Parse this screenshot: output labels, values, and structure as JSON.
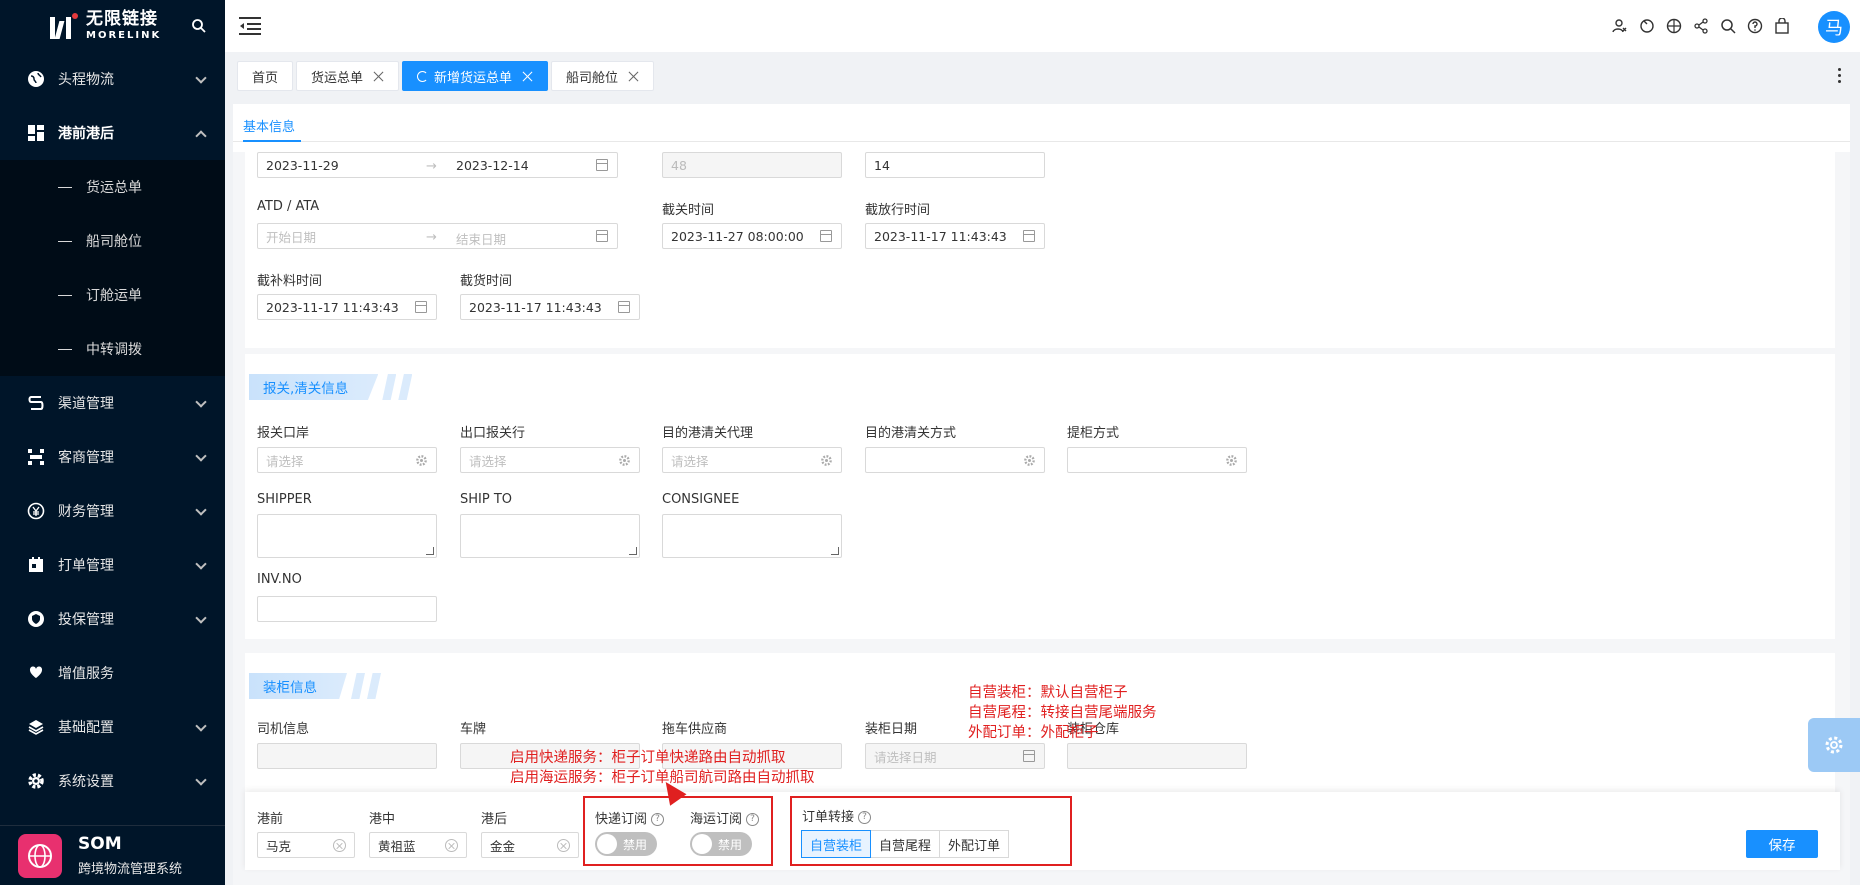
{
  "logo": {
    "cn": "无限链接",
    "en": "MORELINK"
  },
  "sidebar": {
    "items": [
      {
        "label": "头程物流",
        "icon": "globe-icon"
      },
      {
        "label": "港前港后",
        "icon": "dashboard-icon"
      },
      {
        "label": "渠道管理",
        "icon": "route-icon"
      },
      {
        "label": "客商管理",
        "icon": "network-icon"
      },
      {
        "label": "财务管理",
        "icon": "yen-icon"
      },
      {
        "label": "打单管理",
        "icon": "calendar-icon"
      },
      {
        "label": "投保管理",
        "icon": "shield-icon"
      },
      {
        "label": "增值服务",
        "icon": "heart-hand-icon"
      },
      {
        "label": "基础配置",
        "icon": "layers-icon"
      },
      {
        "label": "系统设置",
        "icon": "gear-icon"
      }
    ],
    "subitems": [
      "货运总单",
      "船司舱位",
      "订舱运单",
      "中转调拨"
    ]
  },
  "som": {
    "title": "SOM",
    "subtitle": "跨境物流管理系统"
  },
  "header": {
    "avatar": "马"
  },
  "tabs": [
    {
      "label": "首页",
      "closable": false
    },
    {
      "label": "货运总单",
      "closable": true
    },
    {
      "label": "新增货运总单",
      "closable": true,
      "active": true
    },
    {
      "label": "船司舱位",
      "closable": true
    }
  ],
  "content_tab": "基本信息",
  "basic": {
    "range1_start": "2023-11-29",
    "range1_end": "2023-12-14",
    "days": "48",
    "num": "14",
    "atd_label": "ATD / ATA",
    "atd_start_ph": "开始日期",
    "atd_end_ph": "结束日期",
    "cutoff_customs_label": "截关时间",
    "cutoff_customs": "2023-11-27 08:00:00",
    "cutoff_release_label": "截放行时间",
    "cutoff_release": "2023-11-17 11:43:43",
    "cutoff_supp_label": "截补料时间",
    "cutoff_supp": "2023-11-17 11:43:43",
    "cutoff_cargo_label": "截货时间",
    "cutoff_cargo": "2023-11-17 11:43:43"
  },
  "customs": {
    "title": "报关,清关信息",
    "port_label": "报关口岸",
    "export_label": "出口报关行",
    "dest_agent_label": "目的港清关代理",
    "dest_method_label": "目的港清关方式",
    "pickup_label": "提柜方式",
    "select_ph": "请选择",
    "shipper_label": "SHIPPER",
    "shipto_label": "SHIP TO",
    "consignee_label": "CONSIGNEE",
    "inv_label": "INV.NO"
  },
  "loading": {
    "title": "装柜信息",
    "driver_label": "司机信息",
    "plate_label": "车牌",
    "truck_label": "拖车供应商",
    "date_label": "装柜日期",
    "date_ph": "请选择日期",
    "warehouse_label": "装柜仓库"
  },
  "footer": {
    "pre_label": "港前",
    "pre_value": "马克",
    "mid_label": "港中",
    "mid_value": "黄祖蓝",
    "post_label": "港后",
    "post_value": "金金",
    "express_label": "快递订阅",
    "sea_label": "海运订阅",
    "toggle_text": "禁用",
    "convert_label": "订单转接",
    "seg": [
      "自营装柜",
      "自营尾程",
      "外配订单"
    ],
    "save": "保存"
  },
  "annotations": {
    "left": [
      "启用快递服务：柜子订单快递路由自动抓取",
      "启用海运服务：柜子订单船司航司路由自动抓取"
    ],
    "right": [
      "自营装柜：默认自营柜子",
      "自营尾程：转接自营尾端服务",
      "外配订单：外配柜子"
    ]
  },
  "colors": {
    "accent": "#1890ff",
    "sidebar": "#001529",
    "annotation": "#e02020"
  }
}
